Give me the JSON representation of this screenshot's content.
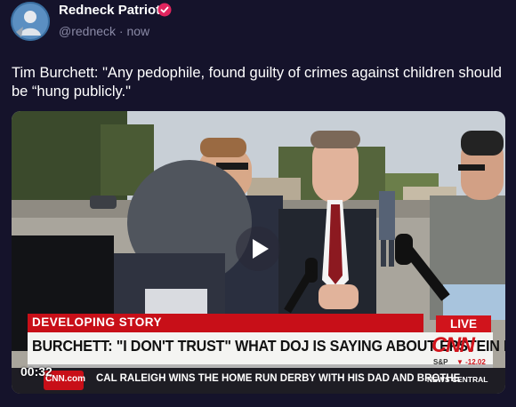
{
  "post": {
    "display_name": "Redneck Patriot",
    "handle": "@redneck",
    "separator": "·",
    "time": "now",
    "text": "Tim Burchett: \"Any pedophile, found guilty of crimes against children should be “hung publicly.\""
  },
  "video": {
    "banner_top": "DEVELOPING STORY",
    "live_label": "LIVE",
    "headline": "BURCHETT: \"I DON'T TRUST\" WHAT DOJ IS SAYING ABOUT EPSTEIN FILES",
    "network_logo": "CNN",
    "ticker_label": "S&P",
    "ticker_value": "▼ -12.02",
    "site": "CNN.com",
    "crawl": "CAL RALEIGH WINS THE HOME RUN DERBY WITH HIS DAD AND BROTHE",
    "show": "NEWS CENTRAL",
    "timestamp": "00:32"
  },
  "colors": {
    "background": "#15132b",
    "verified_badge": "#e0245e",
    "cnn_red": "#d1141c"
  },
  "icons": {
    "verified": "verified-badge-icon",
    "play": "play-icon"
  }
}
